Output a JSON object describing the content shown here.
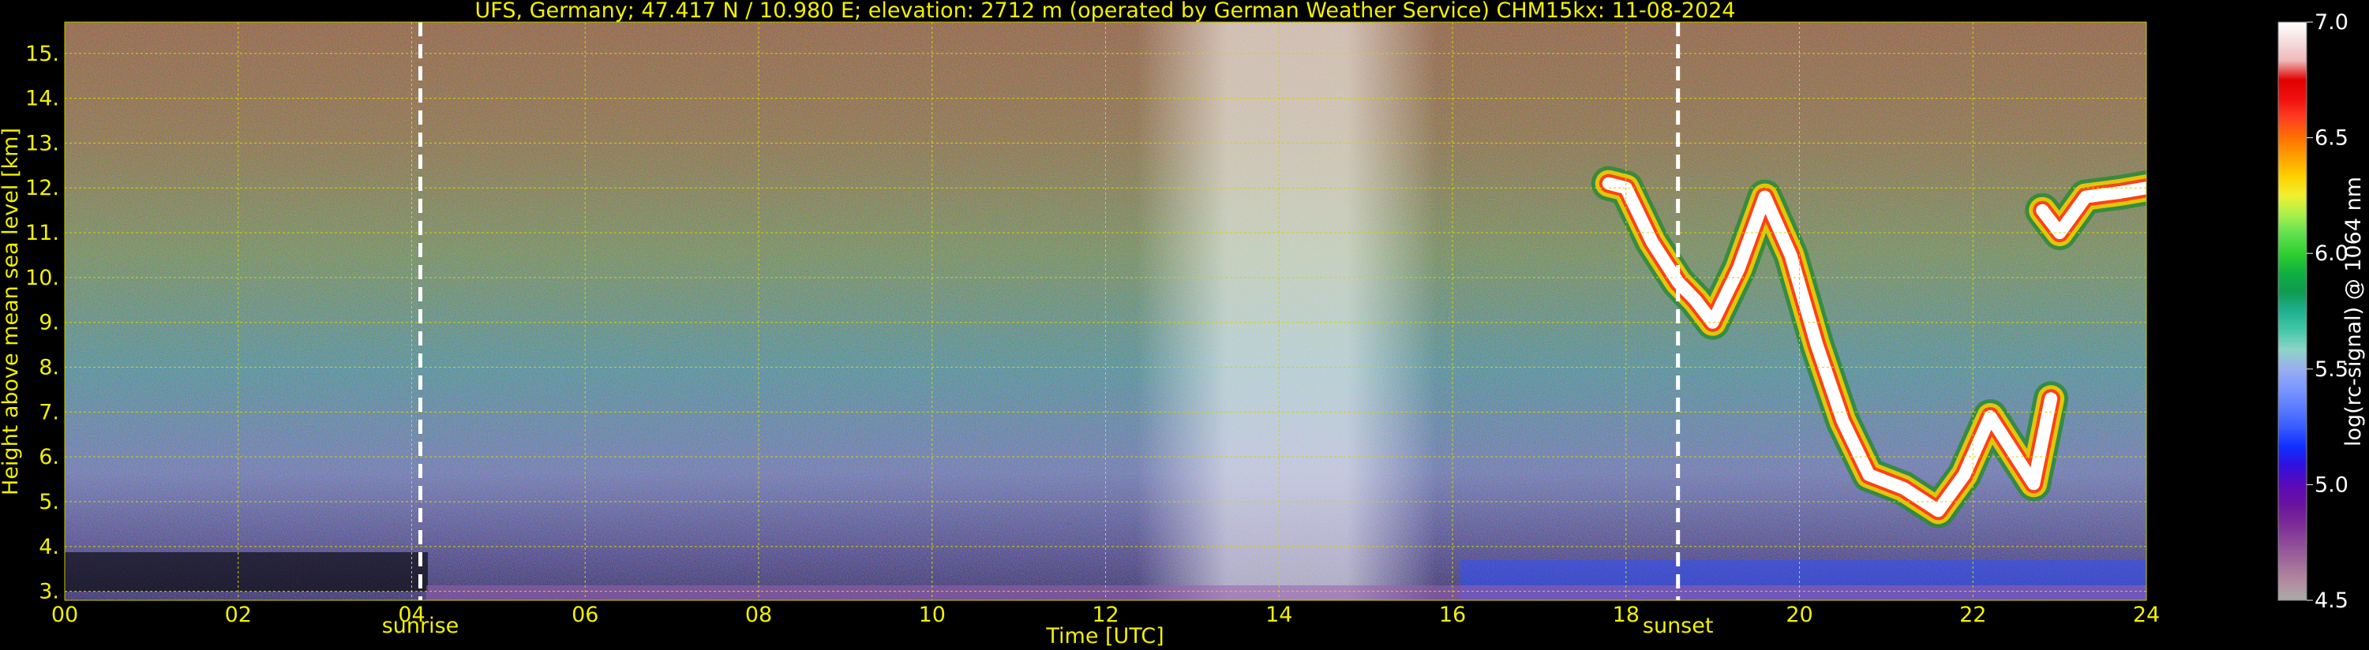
{
  "chart_data": {
    "type": "heatmap",
    "title": "UFS, Germany; 47.417 N / 10.980 E; elevation: 2712 m  (operated by German Weather Service)    CHM15kx: 11-08-2024",
    "xlabel": "Time [UTC]",
    "ylabel": "Height above mean sea level [km]",
    "xlim": [
      0,
      24
    ],
    "ylim": [
      2.8,
      15.7
    ],
    "x_ticks": [
      "00",
      "02",
      "04",
      "06",
      "08",
      "10",
      "12",
      "14",
      "16",
      "18",
      "20",
      "22",
      "24"
    ],
    "y_ticks": [
      "3.",
      "4.",
      "5.",
      "6.",
      "7.",
      "8.",
      "9.",
      "10.",
      "11.",
      "12.",
      "13.",
      "14.",
      "15."
    ],
    "grid": true,
    "events": [
      {
        "label": "sunrise",
        "time": 4.1
      },
      {
        "label": "sunset",
        "time": 18.6
      }
    ],
    "colorbar": {
      "label": "log(rc-signal) @ 1064 nm",
      "range": [
        4.5,
        7.0
      ],
      "ticks": [
        "4.5",
        "5.0",
        "5.5",
        "6.0",
        "6.5",
        "7.0"
      ],
      "colors": [
        "#ababab",
        "#b28a9e",
        "#a06a9a",
        "#8e4a99",
        "#7a2a96",
        "#6a12a0",
        "#5a0ab8",
        "#3010e0",
        "#1030ff",
        "#3a5cff",
        "#5b7cff",
        "#7c98ff",
        "#99aef0",
        "#8fd4c8",
        "#44c8a8",
        "#1fb090",
        "#109a50",
        "#10b040",
        "#30d030",
        "#60e050",
        "#a8f04c",
        "#f0f030",
        "#ffd000",
        "#ffa000",
        "#ff7000",
        "#ff4020",
        "#f01010",
        "#e00000",
        "#f0b8b8",
        "#f5dede",
        "#ffffff"
      ]
    },
    "cloud_layer": [
      [
        17.8,
        12.1
      ],
      [
        18.0,
        12.0
      ],
      [
        18.3,
        10.8
      ],
      [
        18.6,
        9.9
      ],
      [
        18.8,
        9.5
      ],
      [
        19.0,
        9.0
      ],
      [
        19.3,
        10.2
      ],
      [
        19.6,
        11.8
      ],
      [
        19.9,
        10.5
      ],
      [
        20.2,
        8.5
      ],
      [
        20.5,
        6.8
      ],
      [
        20.8,
        5.6
      ],
      [
        21.2,
        5.3
      ],
      [
        21.6,
        4.8
      ],
      [
        21.9,
        5.6
      ],
      [
        22.2,
        6.9
      ],
      [
        22.5,
        6.0
      ],
      [
        22.7,
        5.4
      ],
      [
        22.9,
        7.3
      ]
    ],
    "upper_cloud": [
      [
        22.8,
        11.5
      ],
      [
        23.0,
        11.0
      ],
      [
        23.3,
        11.8
      ],
      [
        23.7,
        11.9
      ],
      [
        24.0,
        12.0
      ]
    ]
  }
}
